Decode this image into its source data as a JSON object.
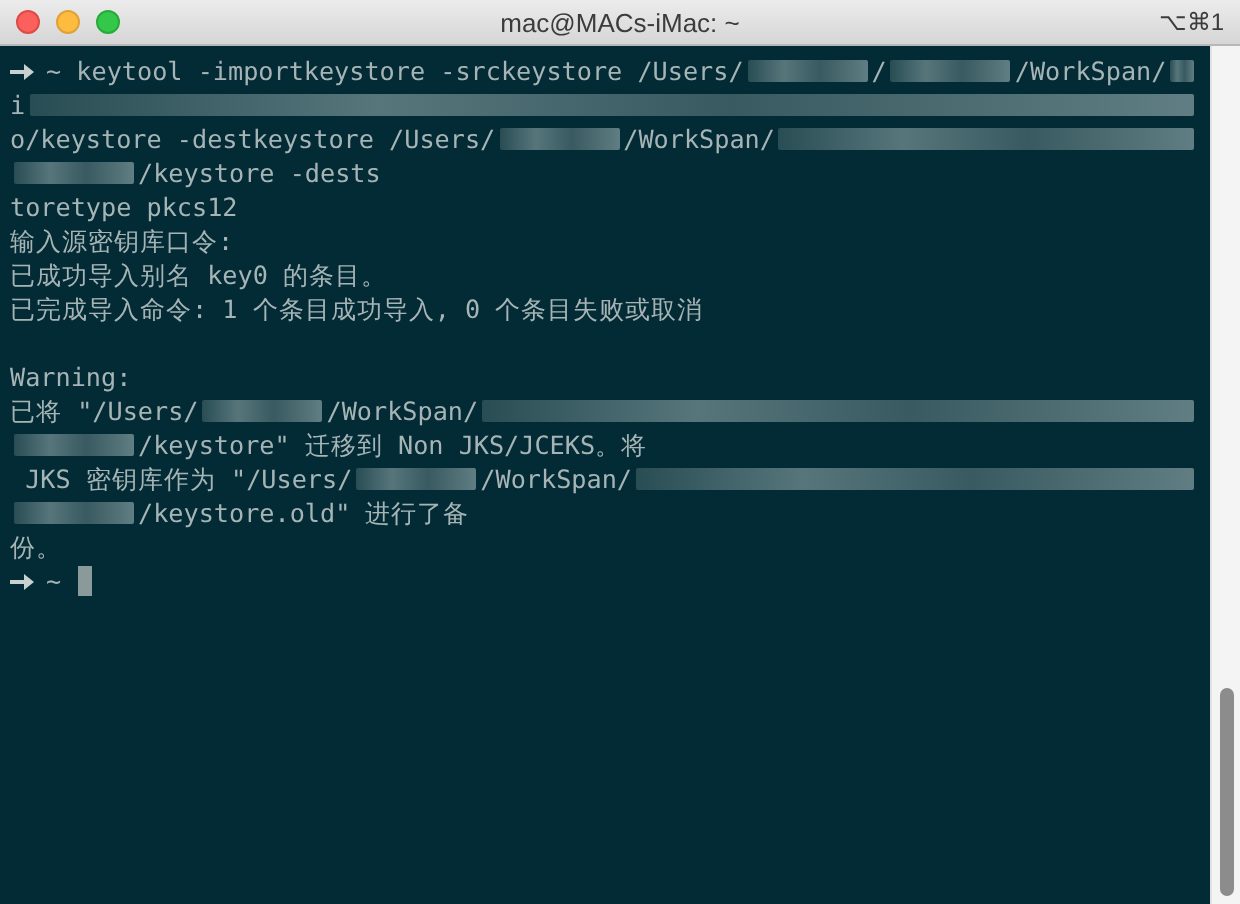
{
  "window": {
    "title": "mac@MACs-iMac: ~",
    "shortcut": "⌥⌘1"
  },
  "terminal": {
    "lines": [
      [
        {
          "kind": "prompt"
        },
        {
          "kind": "text",
          "text": "~ keytool -importkeystore -srckeystore /Users/"
        },
        {
          "kind": "redacted"
        },
        {
          "kind": "text",
          "text": "/"
        },
        {
          "kind": "redacted"
        },
        {
          "kind": "text",
          "text": "/WorkSpan/"
        },
        {
          "kind": "redacted"
        }
      ],
      [
        {
          "kind": "text",
          "text": "i"
        },
        {
          "kind": "redacted"
        }
      ],
      [
        {
          "kind": "text",
          "text": "o/keystore -destkeystore /Users/"
        },
        {
          "kind": "redacted"
        },
        {
          "kind": "text",
          "text": "/WorkSpan/"
        },
        {
          "kind": "redacted"
        }
      ],
      [
        {
          "kind": "redacted"
        },
        {
          "kind": "text",
          "text": "/keystore -dests"
        }
      ],
      [
        {
          "kind": "text",
          "text": "toretype pkcs12"
        }
      ],
      [
        {
          "kind": "text",
          "text": "输入源密钥库口令:"
        }
      ],
      [
        {
          "kind": "text",
          "text": "已成功导入别名 key0 的条目。"
        }
      ],
      [
        {
          "kind": "text",
          "text": "已完成导入命令: 1 个条目成功导入, 0 个条目失败或取消"
        }
      ],
      [
        {
          "kind": "blank"
        }
      ],
      [
        {
          "kind": "text",
          "text": "Warning:"
        }
      ],
      [
        {
          "kind": "text",
          "text": "已将 \"/Users/"
        },
        {
          "kind": "redacted"
        },
        {
          "kind": "text",
          "text": "/WorkSpan/"
        },
        {
          "kind": "redacted"
        }
      ],
      [
        {
          "kind": "redacted"
        },
        {
          "kind": "text",
          "text": "/keystore\" 迁移到 Non JKS/JCEKS。将"
        }
      ],
      [
        {
          "kind": "text",
          "text": " JKS 密钥库作为 \"/Users/"
        },
        {
          "kind": "redacted"
        },
        {
          "kind": "text",
          "text": "/WorkSpan/"
        },
        {
          "kind": "redacted"
        }
      ],
      [
        {
          "kind": "redacted"
        },
        {
          "kind": "text",
          "text": "/keystore.old\" 进行了备"
        }
      ],
      [
        {
          "kind": "text",
          "text": "份。"
        }
      ],
      [
        {
          "kind": "prompt"
        },
        {
          "kind": "text",
          "text": "~"
        },
        {
          "kind": "cursor"
        }
      ]
    ]
  }
}
